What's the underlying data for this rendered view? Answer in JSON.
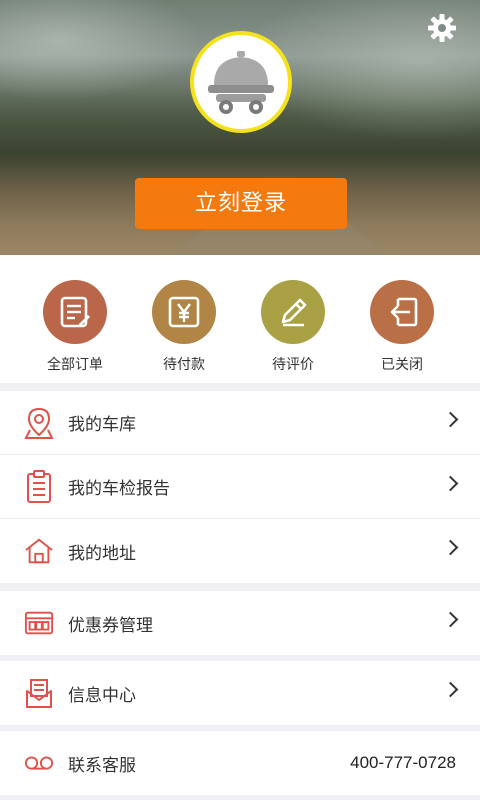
{
  "header": {
    "login_label": "立刻登录"
  },
  "orders": [
    {
      "label": "全部订单",
      "color": "#b9664a"
    },
    {
      "label": "待付款",
      "color": "#b18545"
    },
    {
      "label": "待评价",
      "color": "#a9a144"
    },
    {
      "label": "已关闭",
      "color": "#b97046"
    }
  ],
  "menu": {
    "garage": "我的车库",
    "inspection": "我的车检报告",
    "address": "我的地址",
    "coupon": "优惠券管理",
    "messages": "信息中心",
    "service": "联系客服",
    "service_phone": "400-777-0728"
  },
  "colors": {
    "accent": "#f47a10",
    "icon_red": "#e0514a",
    "avatar_ring": "#f4e21c"
  }
}
